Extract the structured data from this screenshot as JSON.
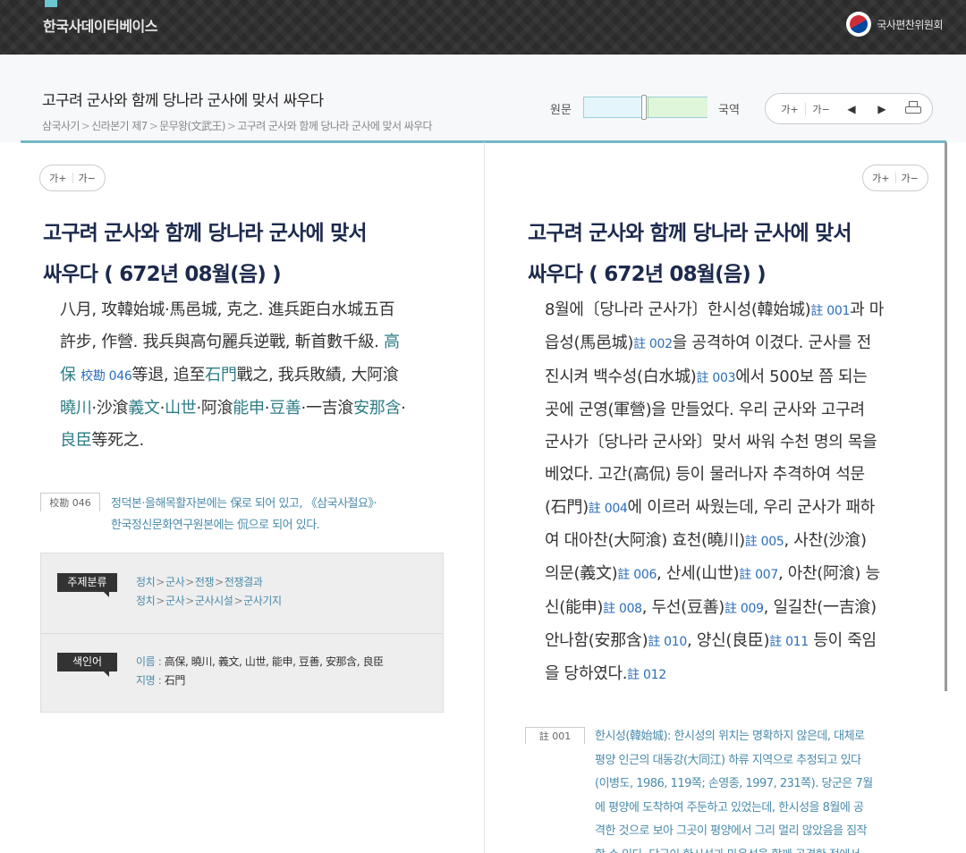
{
  "site": {
    "name": "한국사데이터베이스",
    "org": "국사편찬위원회"
  },
  "header": {
    "title": "고구려 군사와 함께 당나라 군사에 맞서 싸우다",
    "breadcrumb": [
      "삼국사기",
      "신라본기 제7",
      "문무왕(文武王)",
      "고구려 군사와 함께 당나라 군사에 맞서 싸우다"
    ],
    "view_left": "원문",
    "view_right": "국역",
    "tools": {
      "font_up": "가+",
      "font_down": "가−",
      "prev": "◀",
      "next": "▶"
    }
  },
  "font_control": {
    "up": "가+",
    "down": "가−"
  },
  "left": {
    "title_line1": "고구려 군사와 함께 당나라 군사에 맞서",
    "title_line2": "싸우다 ( 672년 08월(음) )",
    "text": {
      "l1": "八月, 攻韓始城·馬邑城, 克之. 進兵距白水城五百",
      "l2a": "許步, 作營. 我兵與高句麗兵逆戰, 斬首數千級. ",
      "l2b": "高",
      "l3a": "保",
      "l3note": "校勘 046",
      "l3b": "等退, 追至",
      "l3c": "石門",
      "l3d": "戰之, 我兵敗績, 大阿湌",
      "l4a": "曉川",
      "l4b": "·沙湌",
      "l4c": "義文",
      "l4d": "·",
      "l4e": "山世",
      "l4f": "·阿湌",
      "l4g": "能申",
      "l4h": "·",
      "l4i": "豆善",
      "l4j": "·一吉湌",
      "l4k": "安那含",
      "l4l": "·",
      "l5a": "良臣",
      "l5b": "等死之."
    },
    "collation": {
      "tag": "校勘 046",
      "line1": "정덕본·을해목활자본에는 保로 되어 있고, 《삼국사절요》·",
      "line2": "한국정신문화연구원본에는 侃으로 되어 있다."
    },
    "classification": {
      "topic_tag": "주제분류",
      "topic1": [
        "정치",
        "군사",
        "전쟁",
        "전쟁결과"
      ],
      "topic2": [
        "정치",
        "군사",
        "군사시설",
        "군사기지"
      ],
      "index_tag": "색인어",
      "names_label": "이름 : ",
      "names": "高保, 曉川, 義文, 山世, 能申, 豆善, 安那含, 良臣",
      "places_label": "지명 : ",
      "places": "石門"
    }
  },
  "right": {
    "title_line1": "고구려 군사와 함께 당나라 군사에 맞서",
    "title_line2": "싸우다 ( 672년 08월(음) )",
    "text": {
      "r1a": "8월에〔당나라 군사가〕한시성(韓始城)",
      "r1n": "註 001",
      "r1b": "과 마",
      "r2a": "읍성(馬邑城)",
      "r2n": "註 002",
      "r2b": "을 공격하여 이겼다. 군사를 전",
      "r3a": "진시켜 백수성(白水城)",
      "r3n": "註 003",
      "r3b": "에서 500보 쯤 되는",
      "r4": "곳에 군영(軍營)을 만들었다. 우리 군사와 고구려",
      "r5": "군사가〔당나라 군사와〕맞서 싸워 수천 명의 목을",
      "r6": "베었다. 고간(高侃) 등이 물러나자 추격하여 석문",
      "r7a": "(石門)",
      "r7n": "註 004",
      "r7b": "에 이르러 싸웠는데, 우리 군사가 패하",
      "r8a": "여 대아찬(大阿湌) 효천(曉川)",
      "r8n": "註 005",
      "r8b": ", 사찬(沙湌)",
      "r9a": "의문(義文)",
      "r9n": "註 006",
      "r9b": ", 산세(山世)",
      "r9n2": "註 007",
      "r9c": ", 아찬(阿湌) 능",
      "r10a": "신(能申)",
      "r10n": "註 008",
      "r10b": ", 두선(豆善)",
      "r10n2": "註 009",
      "r10c": ", 일길찬(一吉湌)",
      "r11a": "안나함(安那含)",
      "r11n": "註 010",
      "r11b": ", 양신(良臣)",
      "r11n2": "註 011",
      "r11c": " 등이 죽임",
      "r12a": "을 당하였다.",
      "r12n": "註 012"
    },
    "footnote": {
      "tag": "註 001",
      "line1": "한시성(韓始城): 한시성의 위치는 명확하지 않은데, 대체로",
      "line2": "평양 인근의 대동강(大同江) 하류 지역으로 추정되고 있다",
      "line3": "(이병도, 1986, 119쪽; 손영종, 1997, 231쪽). 당군은 7월",
      "line4": "에 평양에 도착하여 주둔하고 있었는데, 한시성을 8월에 공",
      "line5": "격한 것으로 보아 그곳이 평양에서 그리 멀리 않았음을 짐작",
      "line6": "할 수 있다. 당군이 한시성과 마읍성을 함께 공격한 점에서"
    }
  }
}
